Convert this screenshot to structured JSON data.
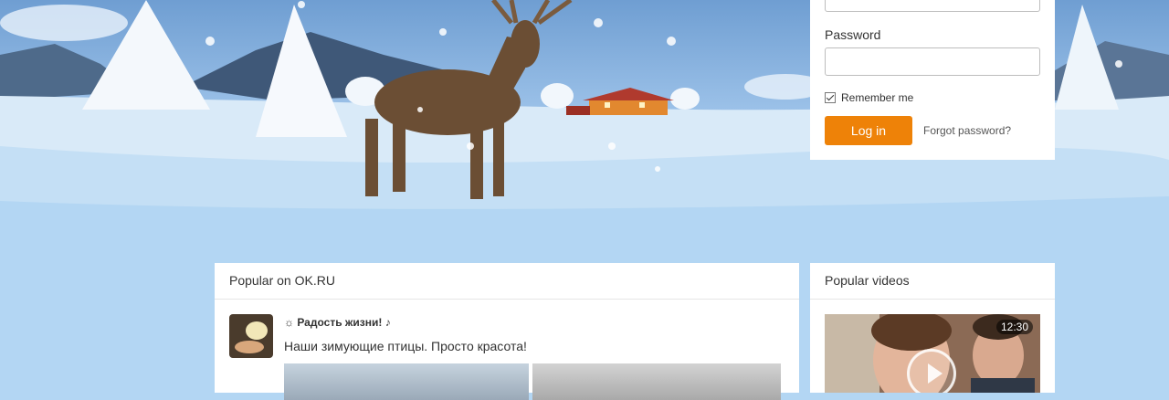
{
  "login": {
    "password_label": "Password",
    "remember_label": "Remember me",
    "remember_checked": true,
    "login_button": "Log in",
    "forgot_link": "Forgot password?"
  },
  "popular": {
    "title": "Popular on OK.RU",
    "post": {
      "group_name": "☼ Радость жизни! ♪",
      "text": "Наши зимующие птицы. Просто красота!"
    }
  },
  "videos": {
    "title": "Popular videos",
    "item": {
      "duration": "12:30"
    }
  },
  "icons": {
    "checkbox": "checkmark-icon",
    "play": "play-icon"
  },
  "colors": {
    "accent": "#ee8208",
    "background": "#b3d6f3"
  }
}
